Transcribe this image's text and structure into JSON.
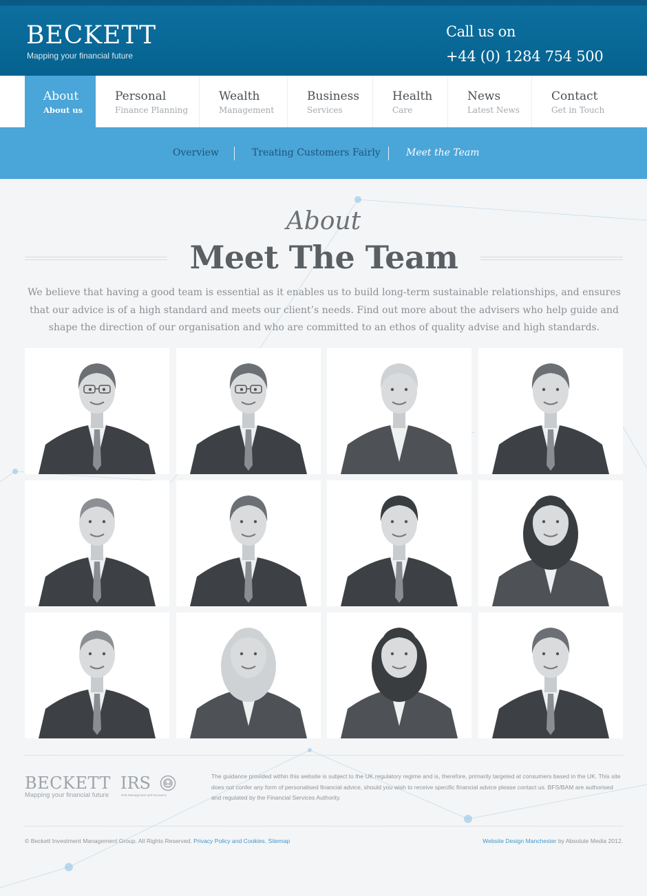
{
  "header": {
    "logo_title": "BECKETT",
    "logo_tagline": "Mapping your financial future",
    "call_label": "Call us on",
    "call_number": "+44 (0) 1284 754 500"
  },
  "nav": {
    "items": [
      {
        "main": "About",
        "sub": "About us",
        "active": true
      },
      {
        "main": "Personal",
        "sub": "Finance Planning"
      },
      {
        "main": "Wealth",
        "sub": "Management"
      },
      {
        "main": "Business",
        "sub": "Services"
      },
      {
        "main": "Health",
        "sub": "Care"
      },
      {
        "main": "News",
        "sub": "Latest News"
      },
      {
        "main": "Contact",
        "sub": "Get in Touch"
      }
    ]
  },
  "subnav": {
    "items": [
      {
        "label": "Overview"
      },
      {
        "label": "Treating Customers Fairly"
      },
      {
        "label": "Meet the Team",
        "current": true
      }
    ]
  },
  "content": {
    "eyebrow": "About",
    "title": "Meet The Team",
    "intro": "We believe that having a good team is essential as it enables us to build long-term sustainable relationships, and ensures that our advice is of a high standard and meets our client’s needs. Find out more about the advisers who help guide and shape the direction of our organisation and who are committed to an ethos of quality advise and high standards."
  },
  "team": {
    "members": [
      {
        "kind": "man-glasses"
      },
      {
        "kind": "man-glasses"
      },
      {
        "kind": "woman-short-fair"
      },
      {
        "kind": "man"
      },
      {
        "kind": "man-balding"
      },
      {
        "kind": "man"
      },
      {
        "kind": "man-dark"
      },
      {
        "kind": "woman-long-dark"
      },
      {
        "kind": "man-balding"
      },
      {
        "kind": "woman-long-fair"
      },
      {
        "kind": "woman-curly-dark"
      },
      {
        "kind": "man"
      }
    ]
  },
  "footer": {
    "logo_title": "BECKETT",
    "logo_tagline": "Mapping your financial future",
    "irs_title": "IRS",
    "irs_tagline": "Risk Management and Insurance",
    "disclaimer": "The guidance provided within this website is subject to the UK regulatory regime and is, therefore, primarily targeted at consumers based in the UK. This site does not confer any form of personalised financial advice, should you wish to receive specific financial advice please contact us. BFS/BAM are authorised and regulated by the Financial Services Authority.",
    "copyright": "© Beckett Investment Management Group. All Rights Reserved.",
    "privacy_link": "Privacy Policy and Cookies",
    "sitemap_link": "Sitemap",
    "credit_link": "Website Design Manchester",
    "credit_suffix": "by Absolute Media 2012."
  },
  "colors": {
    "header_blue": "#05628f",
    "accent_blue": "#4aa5d8",
    "link_blue": "#3f97cc"
  }
}
